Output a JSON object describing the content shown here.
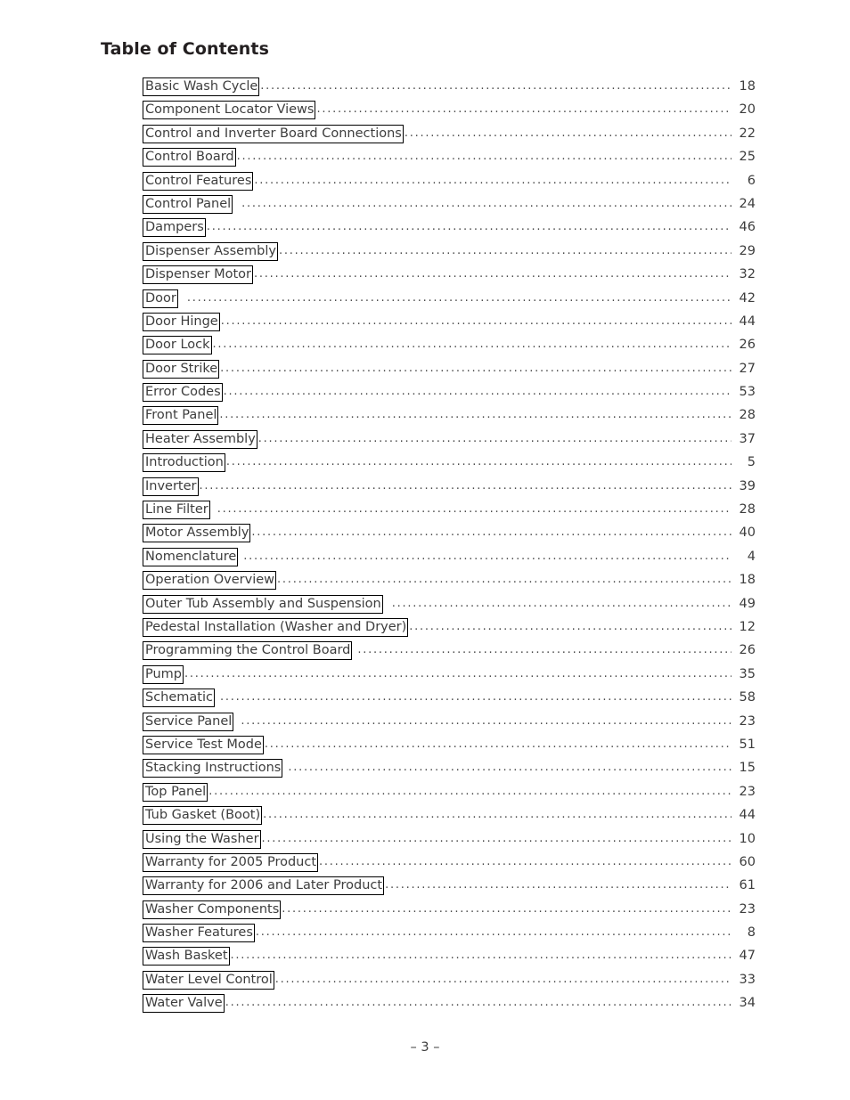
{
  "document": {
    "title": "Table of Contents",
    "footer_page_marker": "– 3 –"
  },
  "toc": {
    "entries": [
      {
        "label": "Basic Wash Cycle",
        "page": "18",
        "gap": 0
      },
      {
        "label": "Component Locator Views",
        "page": "20",
        "gap": 0
      },
      {
        "label": "Control and Inverter Board Connections",
        "page": "22",
        "gap": 0
      },
      {
        "label": "Control Board",
        "page": "25",
        "gap": 0
      },
      {
        "label": "Control Features",
        "page": "6",
        "gap": 0
      },
      {
        "label": "Control Panel",
        "page": "24",
        "gap": 9
      },
      {
        "label": "Dampers",
        "page": "46",
        "gap": 0
      },
      {
        "label": "Dispenser Assembly",
        "page": "29",
        "gap": 0
      },
      {
        "label": "Dispenser Motor",
        "page": "32",
        "gap": 0
      },
      {
        "label": "Door",
        "page": "42",
        "gap": 9
      },
      {
        "label": "Door Hinge",
        "page": "44",
        "gap": 0
      },
      {
        "label": "Door Lock",
        "page": "26",
        "gap": 0
      },
      {
        "label": "Door Strike",
        "page": "27",
        "gap": 0
      },
      {
        "label": "Error Codes",
        "page": "53",
        "gap": 0
      },
      {
        "label": "Front Panel",
        "page": "28",
        "gap": 0
      },
      {
        "label": "Heater Assembly",
        "page": "37",
        "gap": 0
      },
      {
        "label": "Introduction",
        "page": "5",
        "gap": 0
      },
      {
        "label": "Inverter",
        "page": "39",
        "gap": 0
      },
      {
        "label": "Line Filter",
        "page": "28",
        "gap": 7
      },
      {
        "label": "Motor Assembly",
        "page": "40",
        "gap": 0
      },
      {
        "label": "Nomenclature",
        "page": "4",
        "gap": 5
      },
      {
        "label": "Operation Overview",
        "page": "18",
        "gap": 0
      },
      {
        "label": "Outer Tub Assembly and Suspension",
        "page": "49",
        "gap": 9
      },
      {
        "label": "Pedestal Installation (Washer and Dryer)",
        "page": "12",
        "gap": 0
      },
      {
        "label": "Programming the Control Board",
        "page": "26",
        "gap": 5
      },
      {
        "label": "Pump",
        "page": "35",
        "gap": 0
      },
      {
        "label": "Schematic",
        "page": "58",
        "gap": 5
      },
      {
        "label": "Service Panel",
        "page": "23",
        "gap": 7
      },
      {
        "label": "Service Test Mode",
        "page": "51",
        "gap": 0
      },
      {
        "label": "Stacking Instructions",
        "page": "15",
        "gap": 5
      },
      {
        "label": "Top Panel",
        "page": "23",
        "gap": 0
      },
      {
        "label": "Tub Gasket (Boot)",
        "page": "44",
        "gap": 0
      },
      {
        "label": "Using the Washer",
        "page": "10",
        "gap": 0
      },
      {
        "label": "Warranty for 2005 Product",
        "page": "60",
        "gap": 0
      },
      {
        "label": "Warranty for 2006 and Later Product",
        "page": "61",
        "gap": 0
      },
      {
        "label": "Washer Components",
        "page": "23",
        "gap": 0
      },
      {
        "label": "Washer Features",
        "page": "8",
        "gap": 0
      },
      {
        "label": "Wash Basket",
        "page": "47",
        "gap": 0
      },
      {
        "label": "Water Level Control",
        "page": "33",
        "gap": 0
      },
      {
        "label": "Water Valve",
        "page": "34",
        "gap": 0
      }
    ]
  }
}
